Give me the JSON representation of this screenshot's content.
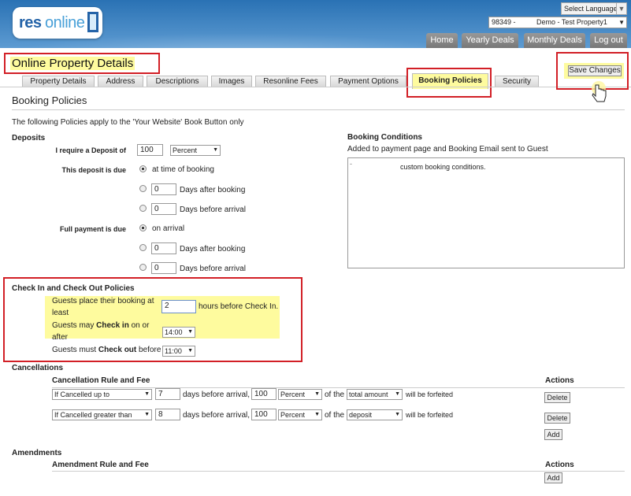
{
  "header": {
    "logo_res": "res",
    "logo_online": "online",
    "language_label": "Select Language",
    "property_id": "98349 -",
    "property_name": "Demo - Test Property1",
    "nav": [
      "Home",
      "Yearly Deals",
      "Monthly Deals",
      "Log out"
    ]
  },
  "page": {
    "title": "Online Property Details",
    "tabs": [
      "Property Details",
      "Address",
      "Descriptions",
      "Images",
      "Resonline Fees",
      "Payment Options",
      "Booking Policies",
      "Security"
    ],
    "active_tab": "Booking Policies",
    "save_label": "Save Changes",
    "section_title": "Booking Policies",
    "intro": "The following Policies apply to the 'Your Website' Book Button only"
  },
  "deposits": {
    "heading": "Deposits",
    "require_label": "I require a Deposit of",
    "deposit_value": "100",
    "deposit_unit": "Percent",
    "due_label": "This deposit is due",
    "opt_time_of_booking": "at time of booking",
    "days_after_booking": "Days after booking",
    "days_before_arrival": "Days before arrival",
    "zero": "0",
    "full_label": "Full payment is due",
    "opt_on_arrival": "on arrival"
  },
  "conditions": {
    "heading": "Booking Conditions",
    "subtitle": "Added to payment page and Booking Email sent to Guest",
    "text_prefix": "-",
    "text": "custom booking conditions."
  },
  "checkin": {
    "heading": "Check In and Check Out Policies",
    "place_label_1": "Guests place their booking at",
    "place_label_2": "least",
    "hours_value": "2",
    "hours_suffix": "hours before Check In.",
    "checkin_pre": "Guests may ",
    "checkin_bold": "Check in",
    "checkin_post": " on or",
    "checkin_line2": "after",
    "checkin_time": "14:00",
    "checkout_pre": "Guests must ",
    "checkout_bold": "Check out",
    "checkout_post": " before",
    "checkout_time": "11:00"
  },
  "cancellations": {
    "heading": "Cancellations",
    "col_rule": "Cancellation Rule and Fee",
    "col_actions": "Actions",
    "rows": [
      {
        "rule": "If Cancelled up to",
        "days": "7",
        "days_text": "days before arrival,",
        "fee": "100",
        "unit": "Percent",
        "of_text": "of the",
        "basis": "total amount",
        "tail": "will be forfeited"
      },
      {
        "rule": "If Cancelled greater than",
        "days": "8",
        "days_text": "days before arrival,",
        "fee": "100",
        "unit": "Percent",
        "of_text": "of the",
        "basis": "deposit",
        "tail": "will be forfeited"
      }
    ],
    "delete_label": "Delete",
    "add_label": "Add"
  },
  "amendments": {
    "heading": "Amendments",
    "col_rule": "Amendment Rule and Fee",
    "col_actions": "Actions",
    "add_label": "Add"
  },
  "colors": {
    "header_blue": "#2a72b4",
    "highlight": "#fefb9e",
    "annotation_red": "#d21f26"
  }
}
